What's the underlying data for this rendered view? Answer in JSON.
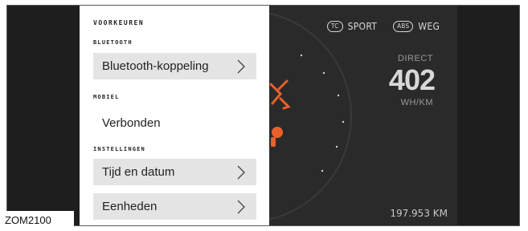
{
  "menu": {
    "title": "VOORKEUREN",
    "sections": {
      "bluetooth": {
        "label": "BLUETOOTH",
        "item": "Bluetooth-koppeling"
      },
      "mobile": {
        "label": "MOBIEL",
        "value": "Verbonden"
      },
      "settings": {
        "label": "INSTELLINGEN",
        "items": [
          "Tijd en datum",
          "Eenheden"
        ]
      }
    }
  },
  "dashboard": {
    "modes": {
      "tc_badge": "TC",
      "sport": "SPORT",
      "abs_badge": "ABS",
      "road": "WEG"
    },
    "direct_label": "DIRECT",
    "direct_value": "402",
    "direct_unit": "WH/KM",
    "odometer": "197.953 KM"
  },
  "figure_code": "ZOM2100",
  "colors": {
    "accent": "#e9602a",
    "panel_bg": "#ffffff",
    "row_bg": "#e4e4e4",
    "dash_bg": "#2a2a2a"
  },
  "icons": [
    "chevron-right-icon",
    "regen-icon",
    "temperature-icon"
  ]
}
